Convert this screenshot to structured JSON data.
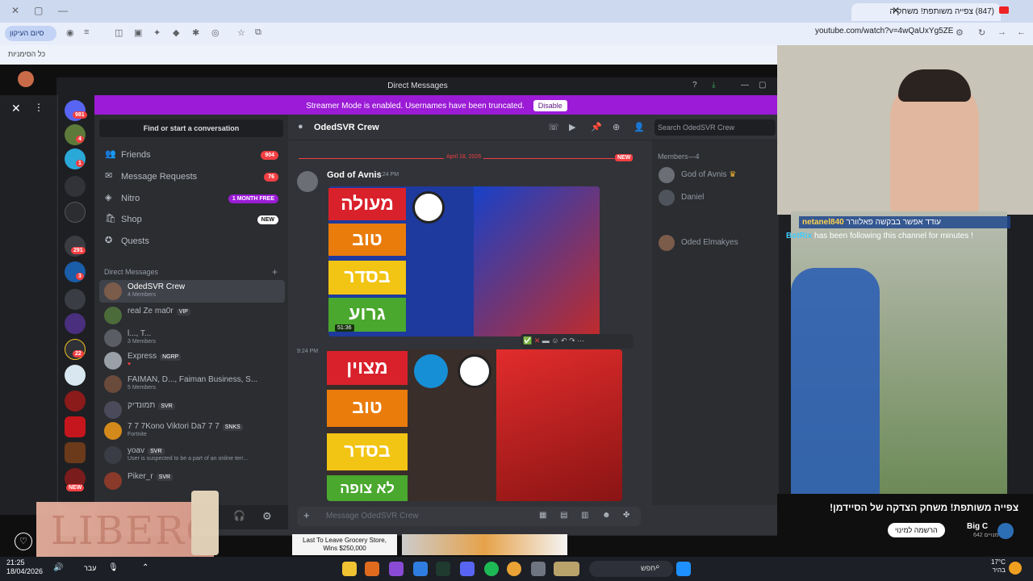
{
  "browser": {
    "tab_title": "(847) צפייה משותפת! משחק ה",
    "url": "youtube.com/watch?v=4wQaUxYg5ZE",
    "side_pill": "סיום העיקון",
    "bookmarks_label": "כל הסימניות"
  },
  "discord": {
    "window_title": "Direct Messages",
    "streamer_banner": "Streamer Mode is enabled. Usernames have been truncated.",
    "disable_label": "Disable",
    "find_conversation": "Find or start a conversation",
    "nav": [
      {
        "label": "Friends",
        "badge": "904"
      },
      {
        "label": "Message Requests",
        "badge": "76"
      },
      {
        "label": "Nitro",
        "badge": "1 MONTH FREE"
      },
      {
        "label": "Shop",
        "badge": "NEW"
      },
      {
        "label": "Quests",
        "badge": ""
      }
    ],
    "dm_header": "Direct Messages",
    "dm_add": "+",
    "dms": [
      {
        "name": "OdedSVR Crew",
        "sub": "4 Members",
        "tag": ""
      },
      {
        "name": "real Ze ma0r",
        "sub": "",
        "tag": "VIP"
      },
      {
        "name": "l..., T...",
        "sub": "3 Members",
        "tag": ""
      },
      {
        "name": "Express",
        "sub": "",
        "tag": "NGRP"
      },
      {
        "name": "FAIMAN, D..., Faiman Business, S...",
        "sub": "5 Members",
        "tag": ""
      },
      {
        "name": "תמונדיק",
        "sub": "",
        "tag": "SVR"
      },
      {
        "name": "7 7 7Kono Viktori Da7 7 7",
        "sub": "Fortnite",
        "tag": "SNKS"
      },
      {
        "name": "yoav",
        "sub": "User is suspected to be a part of an online terr...",
        "tag": "SVR"
      },
      {
        "name": "Piker_r",
        "sub": "",
        "tag": "SVR"
      }
    ],
    "server_badges": [
      "981",
      "4",
      "1",
      "291",
      "3",
      "22"
    ],
    "new_badge": "NEW",
    "chat_title": "OdedSVR Crew",
    "search_placeholder": "Search OdedSVR Crew",
    "date_divider": "April 18, 2026",
    "new_label": "NEW",
    "message_author": "God of Avnis",
    "message_time": "9:24 PM",
    "message_time_2": "9:24 PM",
    "thumb1_tiers": [
      "מעולה",
      "טוב",
      "בסדר",
      "גרוע"
    ],
    "thumb1_duration": "51:36",
    "thumb2_tiers": [
      "מצוין",
      "טוב",
      "בסדר",
      "לא צופה"
    ],
    "composer_placeholder": "Message OdedSVR Crew",
    "members_header": "Members—4",
    "members": [
      "God of Avnis",
      "Daniel",
      "Oded Elmakyes"
    ]
  },
  "stream": {
    "chat_line_1_user": "netanel840",
    "chat_line_1_msg": "עודד אפשר בבקשה פאלוורר",
    "chat_line_2_user": "BotRix",
    "chat_line_2_msg": "has been following this channel for minutes !",
    "video_title": "צפייה משותפת! משחק הצדקה של הסיידמן!",
    "subscribe_label": "הרשמה למינוי",
    "channel_name": "Big C",
    "subscriber_count": "642 מנויים",
    "ad_text_1": "Last To Leave Grocery Store,",
    "ad_text_2": "Wins $250,000",
    "ad_brand": "LIBERO"
  },
  "taskbar": {
    "time": "21:25",
    "date": "18/04/2026",
    "lang": "עבר",
    "search_label": "חפש",
    "temp": "17°C",
    "weather": "בהיר"
  }
}
